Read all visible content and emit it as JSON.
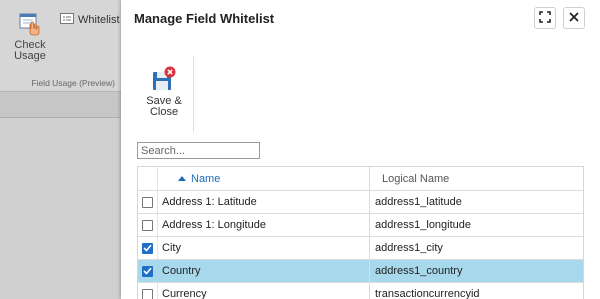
{
  "background": {
    "check_usage_label": "Check Usage",
    "whitelist_label": "Whitelist",
    "group_label": "Field Usage (Preview)"
  },
  "modal": {
    "title": "Manage Field Whitelist",
    "expand_icon": "expand-icon",
    "close_icon": "close-icon",
    "save_close_label": "Save & Close",
    "search_placeholder": "Search...",
    "columns": {
      "name": "Name",
      "logical": "Logical Name"
    },
    "rows": [
      {
        "name": "Address 1: Latitude",
        "logical": "address1_latitude",
        "checked": false,
        "selected": false
      },
      {
        "name": "Address 1: Longitude",
        "logical": "address1_longitude",
        "checked": false,
        "selected": false
      },
      {
        "name": "City",
        "logical": "address1_city",
        "checked": true,
        "selected": false
      },
      {
        "name": "Country",
        "logical": "address1_country",
        "checked": true,
        "selected": true
      },
      {
        "name": "Currency",
        "logical": "transactioncurrencyid",
        "checked": false,
        "selected": false
      }
    ]
  },
  "colors": {
    "accent": "#1f6fc8",
    "selected_row": "#a8d8ec",
    "save_badge": "#d9303a"
  }
}
